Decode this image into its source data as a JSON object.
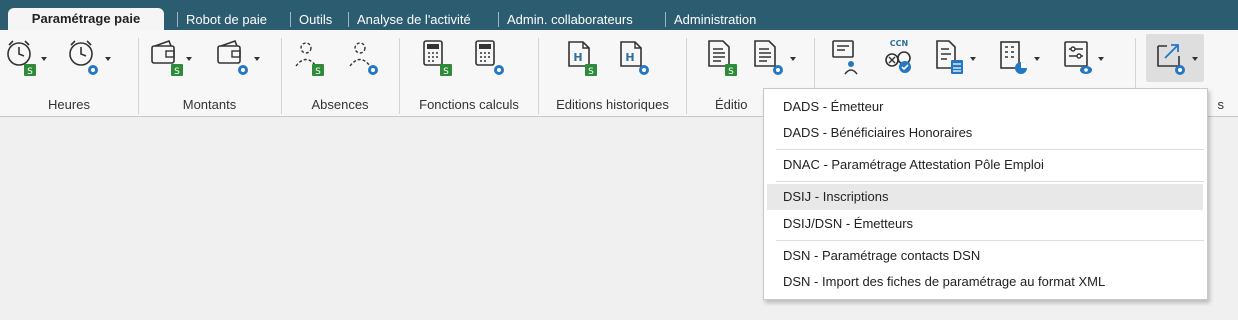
{
  "tabs": [
    {
      "label": "Paramétrage paie",
      "active": true
    },
    {
      "label": "Robot de paie",
      "active": false
    },
    {
      "label": "Outils",
      "active": false
    },
    {
      "label": "Analyse de l'activité",
      "active": false
    },
    {
      "label": "Admin. collaborateurs",
      "active": false
    },
    {
      "label": "Administration",
      "active": false
    }
  ],
  "ribbon": {
    "groups": [
      {
        "label": "Heures",
        "icons": [
          "clock-s-icon",
          "clock-settings-icon"
        ]
      },
      {
        "label": "Montants",
        "icons": [
          "wallet-s-icon",
          "wallet-settings-icon"
        ]
      },
      {
        "label": "Absences",
        "icons": [
          "person-s-icon",
          "person-settings-icon"
        ]
      },
      {
        "label": "Fonctions calculs",
        "icons": [
          "calculator-s-icon",
          "calculator-settings-icon"
        ]
      },
      {
        "label": "Editions historiques",
        "icons": [
          "history-doc-s-icon",
          "history-doc-settings-icon"
        ]
      },
      {
        "label": "Éditio",
        "icons": [
          "document-s-icon",
          "document-settings-icon"
        ]
      },
      {
        "label": "",
        "icons": [
          "user-form-icon",
          "ccn-icon",
          "list-calc-icon",
          "building-icon",
          "view-settings-icon"
        ]
      },
      {
        "label": "s",
        "icons": [
          "export-settings-icon"
        ]
      }
    ],
    "ccn_text": "CCN",
    "badge_s": "S"
  },
  "dropdown": {
    "items": [
      "DADS - Émetteur",
      "DADS - Bénéficiaires Honoraires",
      "DNAC - Paramétrage Attestation Pôle Emploi",
      "DSIJ - Inscriptions",
      "DSIJ/DSN - Émetteurs",
      "DSN - Paramétrage contacts DSN",
      "DSN - Import des fiches de paramétrage au format XML"
    ],
    "highlighted": "DSIJ - Inscriptions"
  },
  "colors": {
    "tabbar": "#2b5c70",
    "badge_green": "#2e8b3a",
    "cog_blue": "#2477c4",
    "menu_hover": "#e8e8e8"
  }
}
